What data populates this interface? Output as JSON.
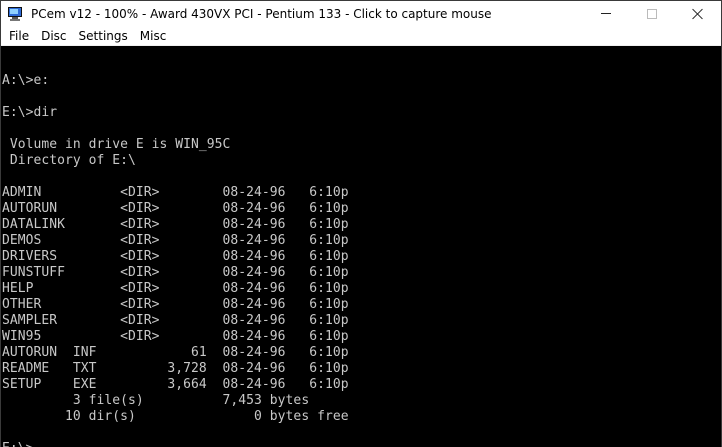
{
  "window": {
    "title": "PCem v12 - 100% - Award 430VX PCI - Pentium 133 - Click to capture mouse",
    "icon": "pcem-monitor-icon",
    "controls": {
      "minimize": "minimize-icon",
      "maximize": "maximize-icon",
      "close": "close-icon"
    }
  },
  "menu": [
    "File",
    "Disc",
    "Settings",
    "Misc"
  ],
  "terminal": {
    "lines": [
      "",
      "A:\\>e:",
      "",
      "E:\\>dir",
      "",
      " Volume in drive E is WIN_95C",
      " Directory of E:\\",
      "",
      "ADMIN          <DIR>        08-24-96   6:10p",
      "AUTORUN        <DIR>        08-24-96   6:10p",
      "DATALINK       <DIR>        08-24-96   6:10p",
      "DEMOS          <DIR>        08-24-96   6:10p",
      "DRIVERS        <DIR>        08-24-96   6:10p",
      "FUNSTUFF       <DIR>        08-24-96   6:10p",
      "HELP           <DIR>        08-24-96   6:10p",
      "OTHER          <DIR>        08-24-96   6:10p",
      "SAMPLER        <DIR>        08-24-96   6:10p",
      "WIN95          <DIR>        08-24-96   6:10p",
      "AUTORUN  INF            61  08-24-96   6:10p",
      "README   TXT         3,728  08-24-96   6:10p",
      "SETUP    EXE         3,664  08-24-96   6:10p",
      "         3 file(s)          7,453 bytes",
      "        10 dir(s)               0 bytes free",
      "",
      "E:\\>"
    ]
  }
}
